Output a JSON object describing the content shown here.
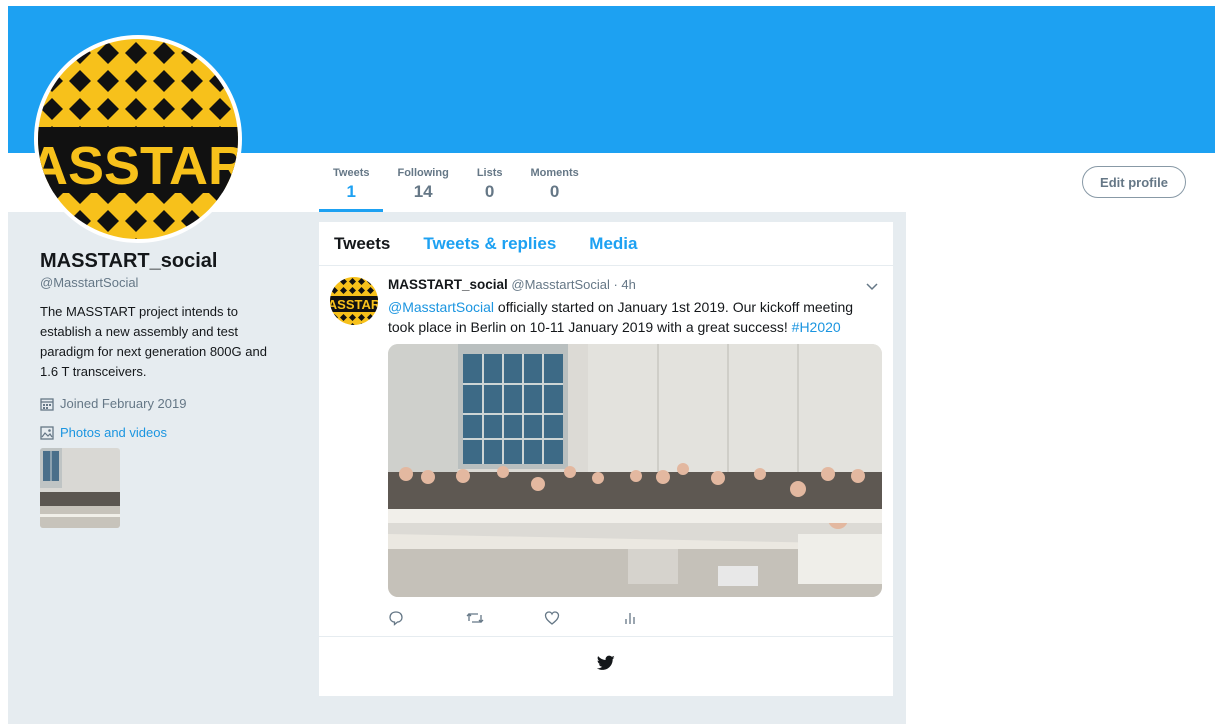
{
  "colors": {
    "accent": "#1da1f2",
    "link": "#1b95e0",
    "muted": "#657786",
    "text": "#14171a",
    "background": "#e6ecf0"
  },
  "avatar": {
    "logo_text": "ASSTAR"
  },
  "nav": {
    "items": [
      {
        "label": "Tweets",
        "value": "1"
      },
      {
        "label": "Following",
        "value": "14"
      },
      {
        "label": "Lists",
        "value": "0"
      },
      {
        "label": "Moments",
        "value": "0"
      }
    ],
    "active": "Tweets"
  },
  "edit_profile_label": "Edit profile",
  "profile": {
    "name": "MASSTART_social",
    "handle": "@MasstartSocial",
    "bio": "The MASSTART project intends to establish a new assembly and test paradigm for next generation 800G and 1.6 T transceivers.",
    "joined": "Joined February 2019",
    "photos_label": "Photos and videos",
    "joined_icon": "calendar-icon",
    "photos_icon": "image-icon"
  },
  "timeline": {
    "tabs": [
      {
        "label": "Tweets"
      },
      {
        "label": "Tweets & replies"
      },
      {
        "label": "Media"
      }
    ]
  },
  "tweet": {
    "name": "MASSTART_social",
    "handle": "@MasstartSocial",
    "time": "· 4h",
    "mention": "@MasstartSocial",
    "text": " officially started on January 1st 2019. Our kickoff meeting took place in Berlin on 10-11 January 2019 with a great success! ",
    "hashtag": "#H2020",
    "action_icons": [
      "reply-icon",
      "retweet-icon",
      "like-icon",
      "analytics-icon"
    ]
  },
  "footer_icon": "twitter-bird-icon"
}
